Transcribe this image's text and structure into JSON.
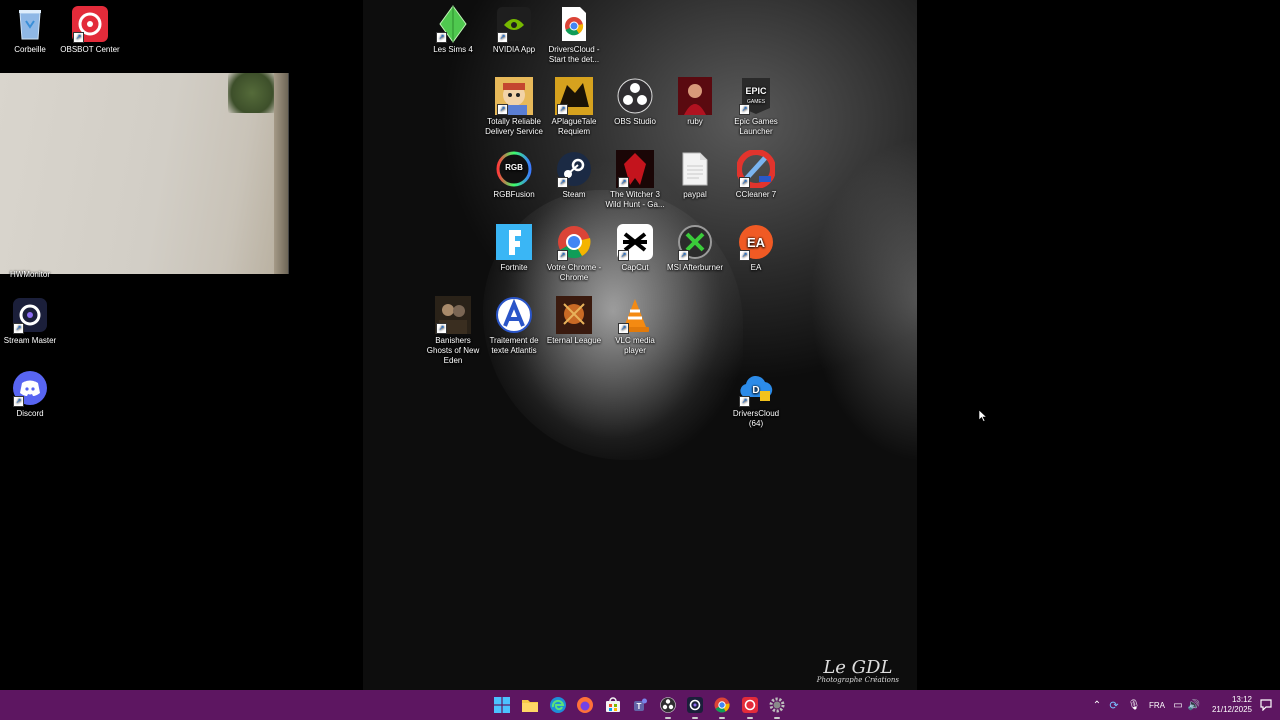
{
  "desktop_left": [
    {
      "name": "recycle-bin",
      "label": "Corbeille"
    },
    {
      "name": "obsbot-center",
      "label": "OBSBOT Center"
    },
    {
      "name": "hwmonitor",
      "label": "HWMonitor"
    },
    {
      "name": "stream-master",
      "label": "Stream Master"
    },
    {
      "name": "discord",
      "label": "Discord"
    }
  ],
  "desktop_center": [
    {
      "label": "Les Sims 4"
    },
    {
      "label": "NVIDIA App"
    },
    {
      "label": "DriversCloud - Start the det..."
    },
    {
      "label": "Totally Reliable Delivery Service"
    },
    {
      "label": "APlagueTale Requiem"
    },
    {
      "label": "OBS Studio"
    },
    {
      "label": "ruby"
    },
    {
      "label": "Epic Games Launcher"
    },
    {
      "label": "RGBFusion"
    },
    {
      "label": "Steam"
    },
    {
      "label": "The Witcher 3 Wild Hunt - Ga..."
    },
    {
      "label": "paypal"
    },
    {
      "label": "CCleaner 7"
    },
    {
      "label": "Fortnite"
    },
    {
      "label": "Votre Chrome - Chrome"
    },
    {
      "label": "CapCut"
    },
    {
      "label": "MSI Afterburner"
    },
    {
      "label": "EA"
    },
    {
      "label": "Banishers Ghosts of New Eden"
    },
    {
      "label": "Traitement de texte Atlantis"
    },
    {
      "label": "Eternal League"
    },
    {
      "label": "VLC media player"
    },
    {
      "label": "DriversCloud (64)"
    }
  ],
  "wallpaper": {
    "sig_line1": "Le GDL",
    "sig_line2": "Photographe Créations"
  },
  "tray": {
    "lang": "FRA",
    "time": "13:12",
    "date": "21/12/2025"
  },
  "colors": {
    "taskbar": "#5d1661",
    "desktop": "#000000"
  }
}
